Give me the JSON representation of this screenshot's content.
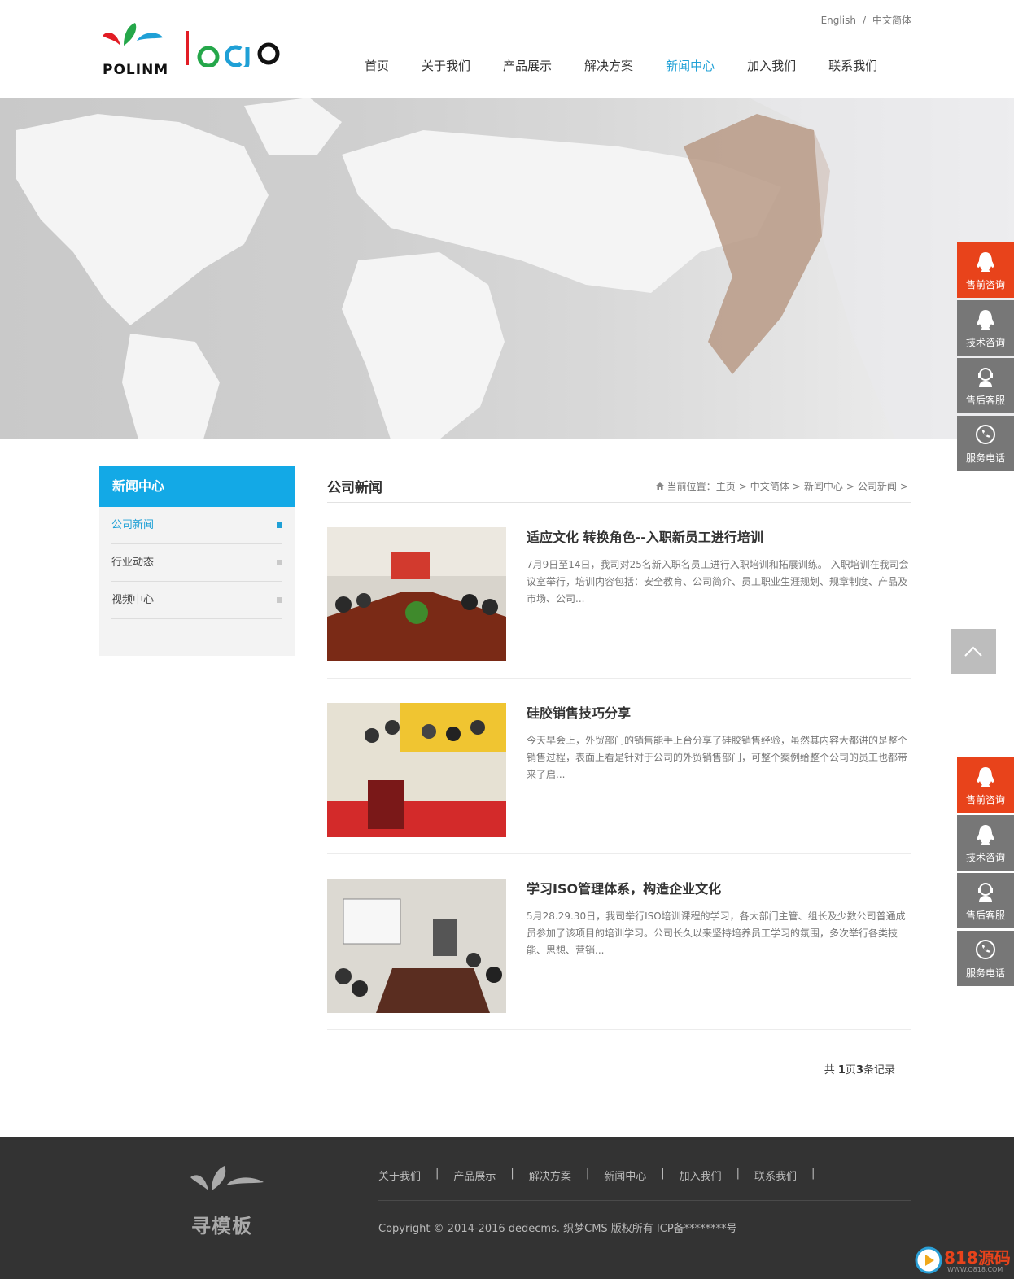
{
  "header": {
    "logo_text": "POLINM",
    "lang": [
      "English",
      "中文简体"
    ],
    "lang_sep": "/",
    "nav": [
      "首页",
      "关于我们",
      "产品展示",
      "解决方案",
      "新闻中心",
      "加入我们",
      "联系我们"
    ],
    "nav_active": "新闻中心"
  },
  "sidebar": {
    "title": "新闻中心",
    "items": [
      "公司新闻",
      "行业动态",
      "视频中心"
    ]
  },
  "content": {
    "title": "公司新闻",
    "breadcrumb_prefix": "当前位置：",
    "breadcrumb": [
      "主页",
      "中文简体",
      "新闻中心",
      "公司新闻"
    ],
    "news": [
      {
        "title": "适应文化 转换角色--入职新员工进行培训",
        "desc": "7月9日至14日，我司对25名新入职名员工进行入职培训和拓展训练。 入职培训在我司会议室举行，培训内容包括：安全教育、公司简介、员工职业生涯规划、规章制度、产品及市场、公司..."
      },
      {
        "title": "硅胶销售技巧分享",
        "desc": "今天早会上，外贸部门的销售能手上台分享了硅胶销售经验，虽然其内容大都讲的是整个销售过程，表面上看是针对于公司的外贸销售部门，可整个案例给整个公司的员工也都带来了启..."
      },
      {
        "title": "学习ISO管理体系，构造企业文化",
        "desc": "5月28.29.30日，我司举行ISO培训课程的学习，各大部门主管、组长及少数公司普通成员参加了该项目的培训学习。公司长久以来坚持培养员工学习的氛围，多次举行各类技能、思想、营销..."
      }
    ],
    "pager": {
      "pre": "共 ",
      "page_count": "1",
      "mid": "页",
      "record_count": "3",
      "post": "条记录"
    }
  },
  "service": [
    "售前咨询",
    "技术咨询",
    "售后客服",
    "服务电话"
  ],
  "footer": {
    "logo_text": "寻模板",
    "nav": [
      "关于我们",
      "产品展示",
      "解决方案",
      "新闻中心",
      "加入我们",
      "联系我们"
    ],
    "copyright": "Copyright © 2014-2016 dedecms. 织梦CMS 版权所有    ICP备********号"
  },
  "badge": {
    "main": "818源码",
    "sub": "WWW.Q818.COM"
  },
  "colors": {
    "accent": "#13a9e6",
    "service_highlight": "#e8431b",
    "footer_bg": "#333333"
  }
}
